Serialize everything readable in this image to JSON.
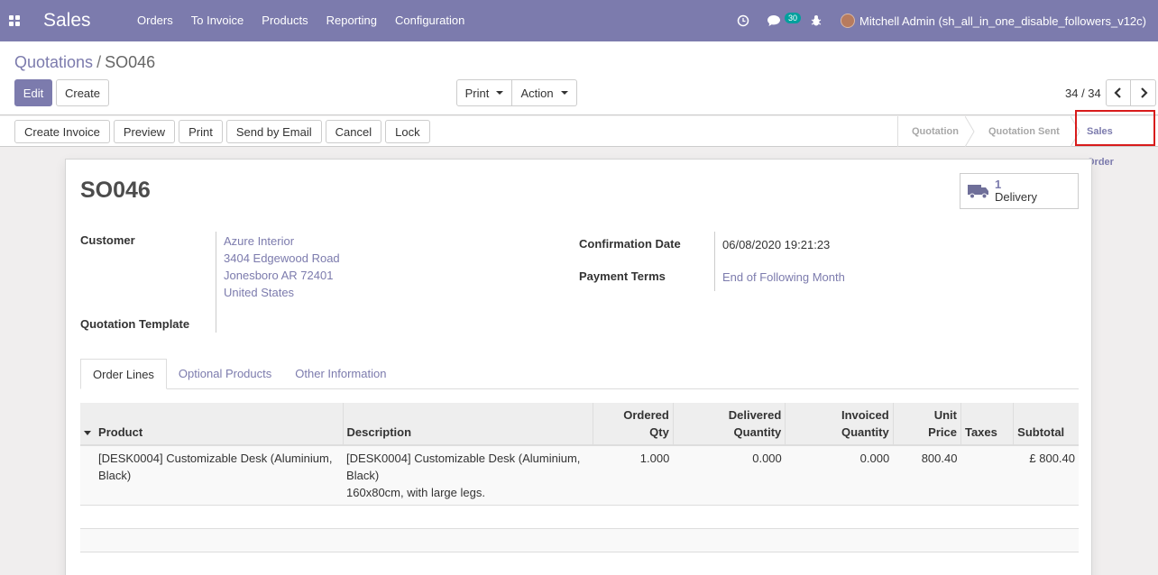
{
  "navbar": {
    "app_name": "Sales",
    "menu": [
      "Orders",
      "To Invoice",
      "Products",
      "Reporting",
      "Configuration"
    ],
    "messages_count": "30",
    "user": "Mitchell Admin (sh_all_in_one_disable_followers_v12c)",
    "color": "#7c7bad"
  },
  "control": {
    "breadcrumb_parent": "Quotations",
    "breadcrumb_sep": "/",
    "breadcrumb_current": "SO046",
    "edit_label": "Edit",
    "create_label": "Create",
    "print_label": "Print",
    "action_label": "Action",
    "pager": "34 / 34"
  },
  "header": {
    "buttons": [
      "Create Invoice",
      "Preview",
      "Print",
      "Send by Email",
      "Cancel",
      "Lock"
    ],
    "stages": [
      "Quotation",
      "Quotation Sent",
      "Sales Order"
    ],
    "current_stage": "Sales Order"
  },
  "form": {
    "title": "SO046",
    "smart_button": {
      "value": "1",
      "label": "Delivery"
    },
    "customer_label": "Customer",
    "customer_lines": [
      "Azure Interior",
      "3404 Edgewood Road",
      "Jonesboro AR 72401",
      "United States"
    ],
    "template_label": "Quotation Template",
    "confirmation_label": "Confirmation Date",
    "confirmation_value": "06/08/2020 19:21:23",
    "payment_label": "Payment Terms",
    "payment_value": "End of Following Month"
  },
  "tabs": [
    "Order Lines",
    "Optional Products",
    "Other Information"
  ],
  "table": {
    "headers": {
      "product": "Product",
      "description": "Description",
      "ordered": [
        "Ordered",
        "Qty"
      ],
      "delivered": [
        "Delivered",
        "Quantity"
      ],
      "invoiced": [
        "Invoiced",
        "Quantity"
      ],
      "unit": [
        "Unit",
        "Price"
      ],
      "taxes": "Taxes",
      "subtotal": "Subtotal"
    },
    "row": {
      "product_lines": [
        "[DESK0004] Customizable Desk (Aluminium,",
        "Black)"
      ],
      "description_lines": [
        "[DESK0004] Customizable Desk (Aluminium,",
        "Black)",
        "160x80cm, with large legs."
      ],
      "ordered": "1.000",
      "delivered": "0.000",
      "invoiced": "0.000",
      "unit_price": "800.40",
      "taxes": "",
      "subtotal": "£ 800.40"
    }
  }
}
